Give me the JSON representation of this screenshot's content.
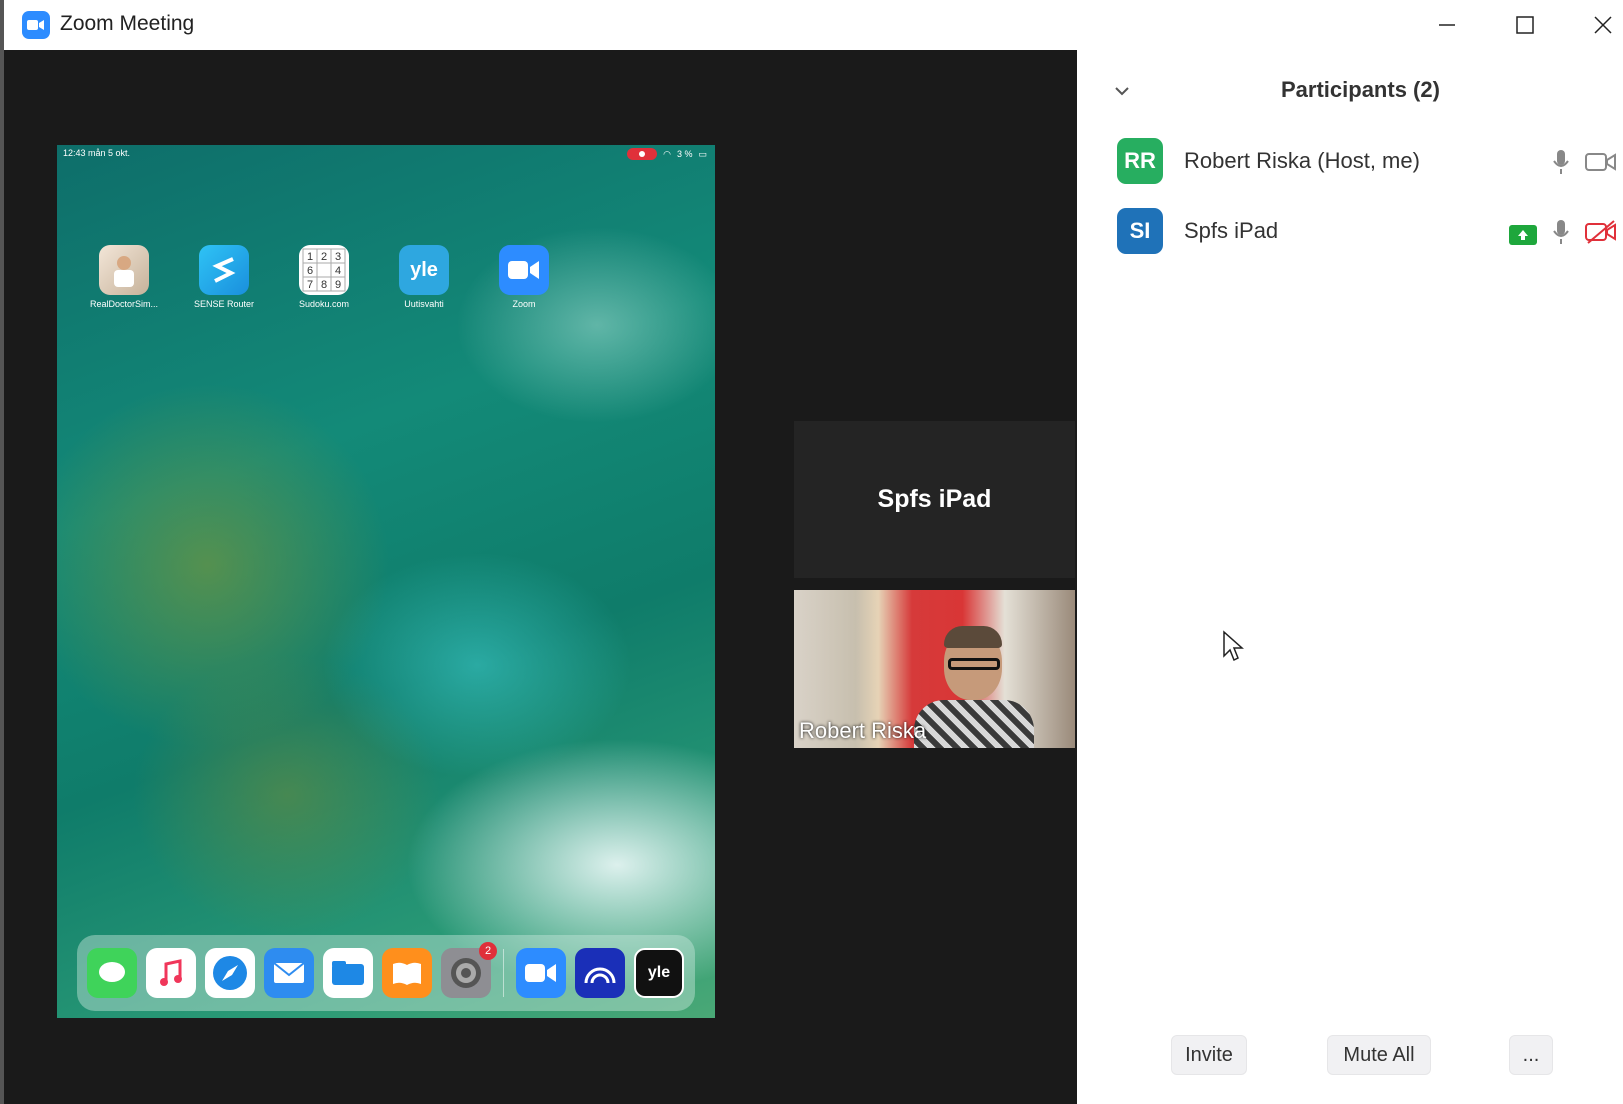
{
  "window": {
    "title": "Zoom Meeting"
  },
  "share_screen": {
    "status_time": "12:43  mån 5 okt.",
    "status_right": "3 %",
    "home_apps": [
      {
        "label": "RealDoctorSim...",
        "icon": "doctor-app-icon"
      },
      {
        "label": "SENSE Router",
        "icon": "sense-router-icon"
      },
      {
        "label": "Sudoku.com",
        "icon": "sudoku-icon"
      },
      {
        "label": "Uutisvahti",
        "icon": "yle-icon",
        "text": "yle"
      },
      {
        "label": "Zoom",
        "icon": "zoom-icon"
      }
    ],
    "dock_badge": "2",
    "dock_yle_text": "yle"
  },
  "tiles": {
    "ipad_name": "Spfs iPad",
    "video_name": "Robert Riska"
  },
  "participants": {
    "title": "Participants (2)",
    "list": [
      {
        "initials": "RR",
        "name": "Robert Riska (Host, me)",
        "avatar_color": "#27ae60"
      },
      {
        "initials": "SI",
        "name": "Spfs iPad",
        "avatar_color": "#1f72b8"
      }
    ],
    "buttons": {
      "invite": "Invite",
      "mute_all": "Mute All",
      "more": "..."
    }
  },
  "colors": {
    "zoom_blue": "#2d8cff",
    "share_green": "#1ea73c",
    "video_off_red": "#e0303a"
  }
}
